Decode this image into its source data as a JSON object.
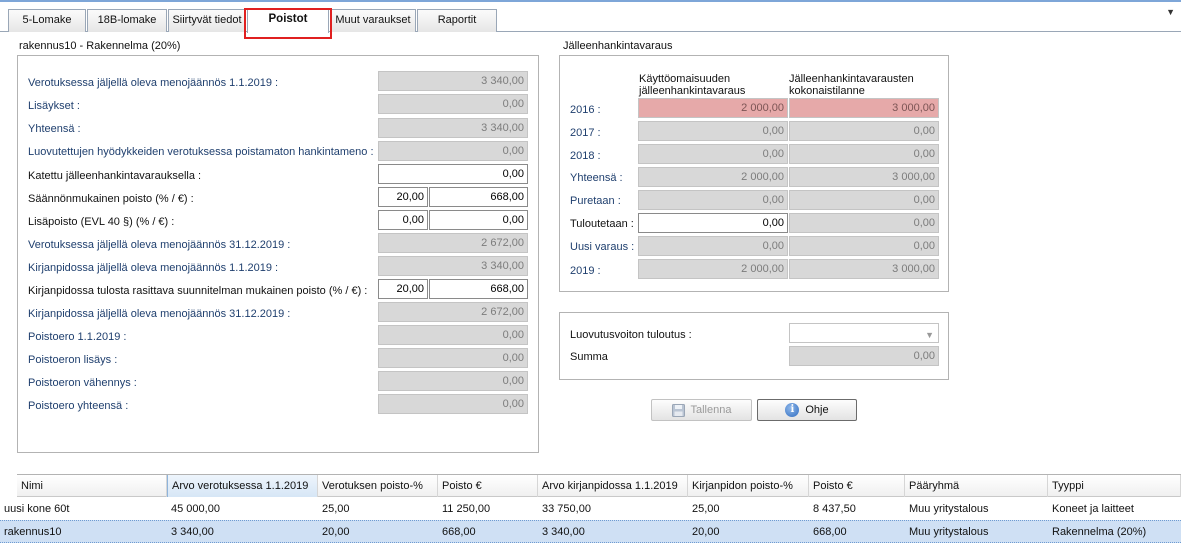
{
  "tabs": [
    {
      "label": "5-Lomake"
    },
    {
      "label": "18B-lomake"
    },
    {
      "label": "Siirtyvät tiedot"
    },
    {
      "label": "Poistot"
    },
    {
      "label": "Muut varaukset"
    },
    {
      "label": "Raportit"
    }
  ],
  "left_panel": {
    "title": "rakennus10 - Rakennelma (20%)",
    "fields": [
      {
        "label": "Verotuksessa jäljellä oleva menojäännös 1.1.2019 :",
        "value": "3 340,00"
      },
      {
        "label": "Lisäykset :",
        "value": "0,00"
      },
      {
        "label": "Yhteensä :",
        "value": "3 340,00"
      },
      {
        "label": "Luovutettujen hyödykkeiden verotuksessa poistamaton hankintameno :",
        "value": "0,00"
      },
      {
        "label": "Katettu jälleenhankintavarauksella :",
        "value": "0,00"
      },
      {
        "label": "Säännönmukainen poisto (% / €) :",
        "percent": "20,00",
        "value": "668,00"
      },
      {
        "label": "Lisäpoisto (EVL 40 §) (% / €) :",
        "percent": "0,00",
        "value": "0,00"
      },
      {
        "label": "Verotuksessa jäljellä oleva menojäännös 31.12.2019 :",
        "value": "2 672,00"
      },
      {
        "label": "Kirjanpidossa jäljellä oleva menojäännös 1.1.2019 :",
        "value": "3 340,00"
      },
      {
        "label": "Kirjanpidossa tulosta rasittava suunnitelman mukainen poisto (% / €) :",
        "percent": "20,00",
        "value": "668,00"
      },
      {
        "label": "Kirjanpidossa jäljellä oleva menojäännös 31.12.2019 :",
        "value": "2 672,00"
      },
      {
        "label": "Poistoero 1.1.2019 :",
        "value": "0,00"
      },
      {
        "label": "Poistoeron lisäys :",
        "value": "0,00"
      },
      {
        "label": "Poistoeron vähennys :",
        "value": "0,00"
      },
      {
        "label": "Poistoero yhteensä :",
        "value": "0,00"
      }
    ]
  },
  "reserve_panel": {
    "title": "Jälleenhankintavaraus",
    "col1": "Käyttöomaisuuden\njälleenhankintavaraus",
    "col2": "Jälleenhankintavarausten\nkokonaistilanne",
    "rows": [
      {
        "label": "2016 :",
        "v1": "2 000,00",
        "v2": "3 000,00"
      },
      {
        "label": "2017 :",
        "v1": "0,00",
        "v2": "0,00"
      },
      {
        "label": "2018 :",
        "v1": "0,00",
        "v2": "0,00"
      },
      {
        "label": "Yhteensä :",
        "v1": "2 000,00",
        "v2": "3 000,00"
      },
      {
        "label": "Puretaan :",
        "v1": "0,00",
        "v2": "0,00"
      },
      {
        "label": "Tuloutetaan :",
        "v1": "0,00",
        "v2": "0,00"
      },
      {
        "label": "Uusi varaus :",
        "v1": "0,00",
        "v2": "0,00"
      },
      {
        "label": "2019 :",
        "v1": "2 000,00",
        "v2": "3 000,00"
      }
    ]
  },
  "gain_panel": {
    "recognition_label": "Luovutusvoiton tuloutus :",
    "recognition_value": "",
    "sum_label": "Summa",
    "sum_value": "0,00"
  },
  "buttons": {
    "save": "Tallenna",
    "help": "Ohje"
  },
  "grid": {
    "columns": [
      "Nimi",
      "Arvo verotuksessa 1.1.2019",
      "Verotuksen poisto-%",
      "Poisto €",
      "Arvo kirjanpidossa 1.1.2019",
      "Kirjanpidon poisto-%",
      "Poisto €",
      "Pääryhmä",
      "Tyyppi"
    ],
    "rows": [
      [
        "uusi kone 60t",
        "45 000,00",
        "25,00",
        "11 250,00",
        "33 750,00",
        "25,00",
        "8 437,50",
        "Muu yritystalous",
        "Koneet ja laitteet"
      ],
      [
        "rakennus10",
        "3 340,00",
        "20,00",
        "668,00",
        "3 340,00",
        "20,00",
        "668,00",
        "Muu yritystalous",
        "Rakennelma (20%)"
      ]
    ]
  }
}
